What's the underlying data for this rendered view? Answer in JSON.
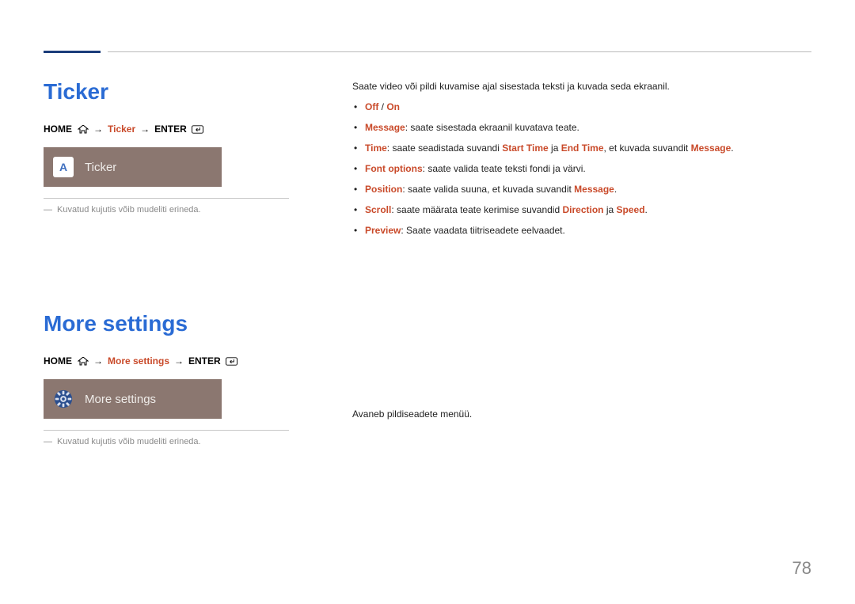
{
  "page_number": "78",
  "section1": {
    "title": "Ticker",
    "breadcrumb": {
      "home": "HOME",
      "arrow1": "→",
      "mid": "Ticker",
      "arrow2": "→",
      "enter": "ENTER"
    },
    "tile": {
      "icon_letter": "A",
      "label": "Ticker"
    },
    "caption_dash": "―",
    "caption": "Kuvatud kujutis võib mudeliti erineda.",
    "intro": "Saate video või pildi kuvamise ajal sisestada teksti ja kuvada seda ekraanil.",
    "bullets": {
      "b1": {
        "off": "Off",
        "slash": " / ",
        "on": "On"
      },
      "b2": {
        "lead": "Message",
        "rest": ": saate sisestada ekraanil kuvatava teate."
      },
      "b3": {
        "lead": "Time",
        "t1": ": saate seadistada suvandi ",
        "k1": "Start Time",
        "t2": " ja ",
        "k2": "End Time",
        "t3": ", et kuvada suvandit ",
        "k3": "Message",
        "t4": "."
      },
      "b4": {
        "lead": "Font options",
        "rest": ": saate valida teate teksti fondi ja värvi."
      },
      "b5": {
        "lead": "Position",
        "t1": ": saate valida suuna, et kuvada suvandit ",
        "k1": "Message",
        "t2": "."
      },
      "b6": {
        "lead": "Scroll",
        "t1": ": saate määrata teate kerimise suvandid ",
        "k1": "Direction",
        "t2": " ja ",
        "k2": "Speed",
        "t3": "."
      },
      "b7": {
        "lead": "Preview",
        "rest": ": Saate vaadata tiitriseadete eelvaadet."
      }
    }
  },
  "section2": {
    "title": "More settings",
    "breadcrumb": {
      "home": "HOME",
      "arrow1": "→",
      "mid": "More settings",
      "arrow2": "→",
      "enter": "ENTER"
    },
    "tile": {
      "label": "More settings"
    },
    "caption_dash": "―",
    "caption": "Kuvatud kujutis võib mudeliti erineda.",
    "intro": "Avaneb pildiseadete menüü."
  }
}
